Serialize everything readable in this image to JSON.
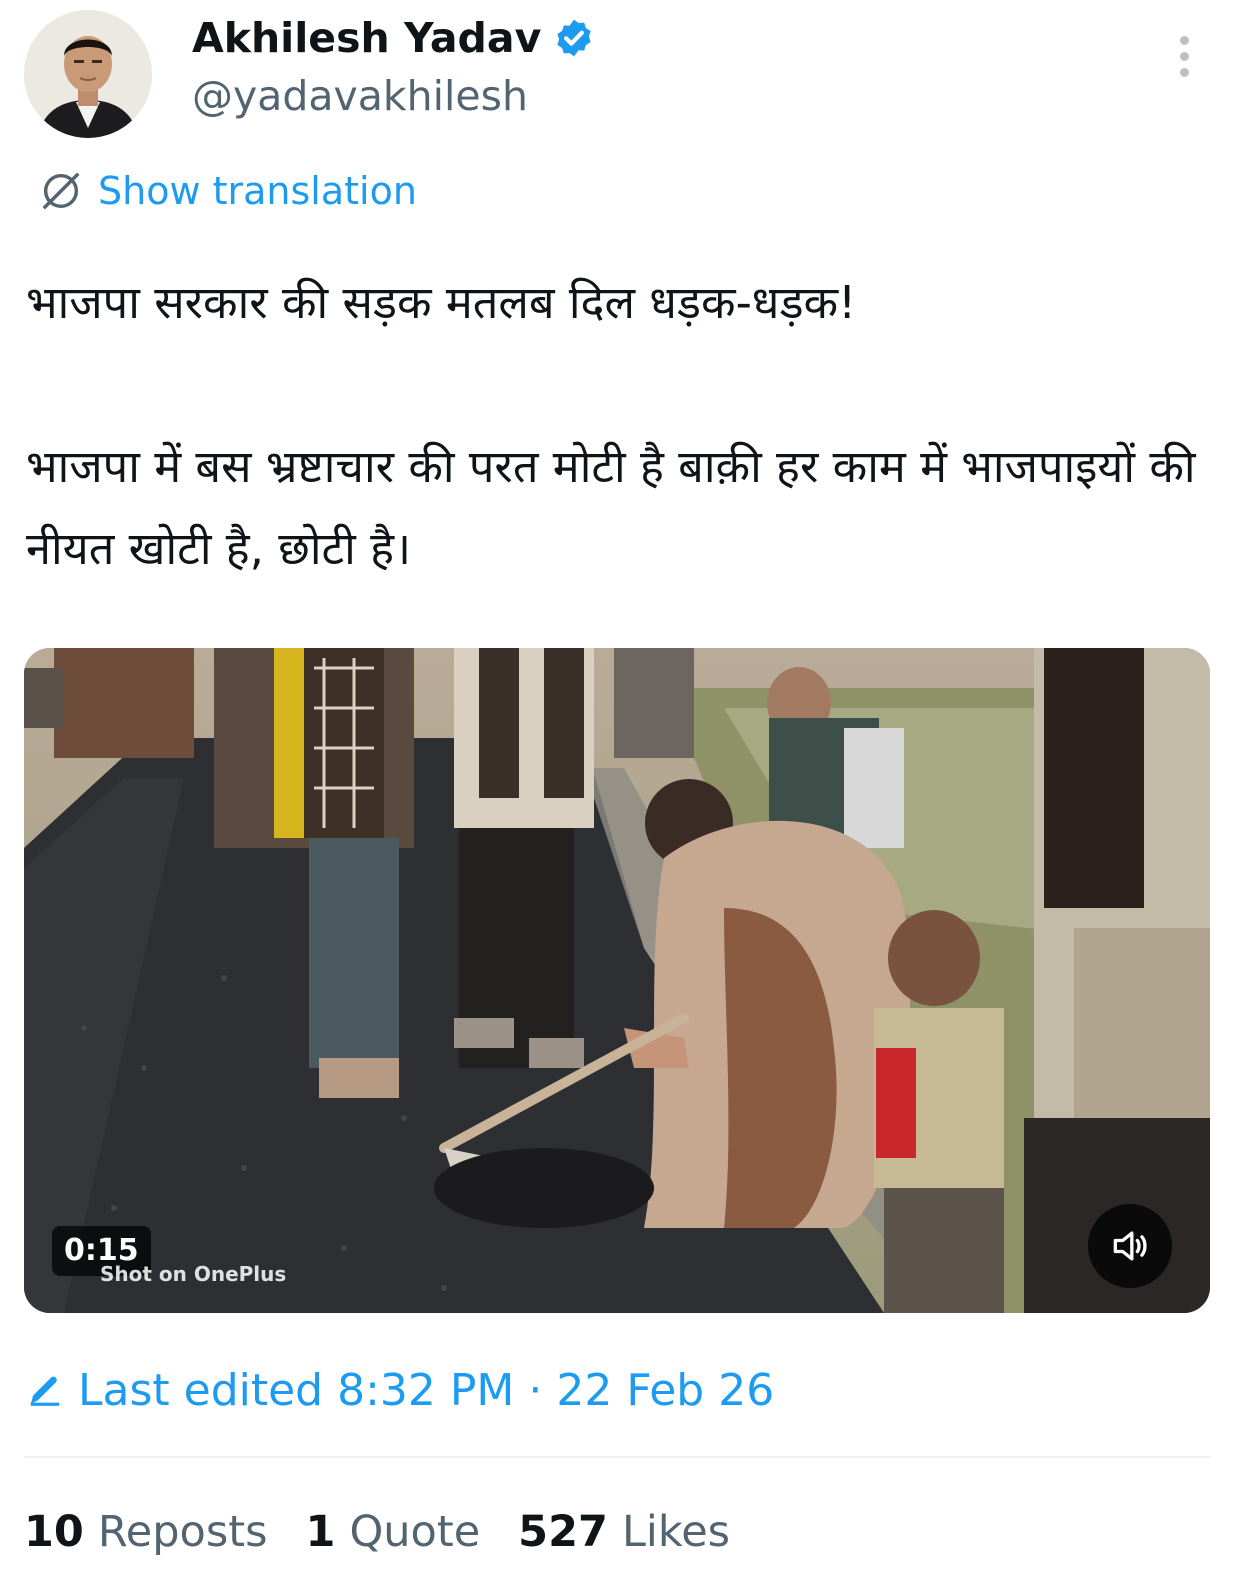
{
  "author": {
    "name": "Akhilesh Yadav",
    "handle": "@yadavakhilesh",
    "verified": true,
    "avatar_icon": "profile-photo"
  },
  "translation": {
    "label": "Show translation",
    "icon": "translate-icon"
  },
  "tweet": {
    "paragraphs": [
      "भाजपा सरकार की सड़क मतलब दिल धड़क-धड़क!",
      "भाजपा में बस भ्रष्टाचार की परत मोटी है बाक़ी हर काम में भाजपाइयों की नीयत खोटी है, छोटी है।"
    ]
  },
  "media": {
    "duration": "0:15",
    "watermark": "Shot on OnePlus",
    "sound_icon": "speaker-muted-icon"
  },
  "edited": {
    "label": "Last edited 8:32 PM · 22 Feb 26",
    "icon": "pencil-icon"
  },
  "stats": [
    {
      "count": "10",
      "label": "Reposts"
    },
    {
      "count": "1",
      "label": "Quote"
    },
    {
      "count": "527",
      "label": "Likes"
    }
  ],
  "colors": {
    "accent": "#1d9bf0",
    "text": "#0f1419",
    "muted": "#536471",
    "divider": "#eff3f4"
  }
}
